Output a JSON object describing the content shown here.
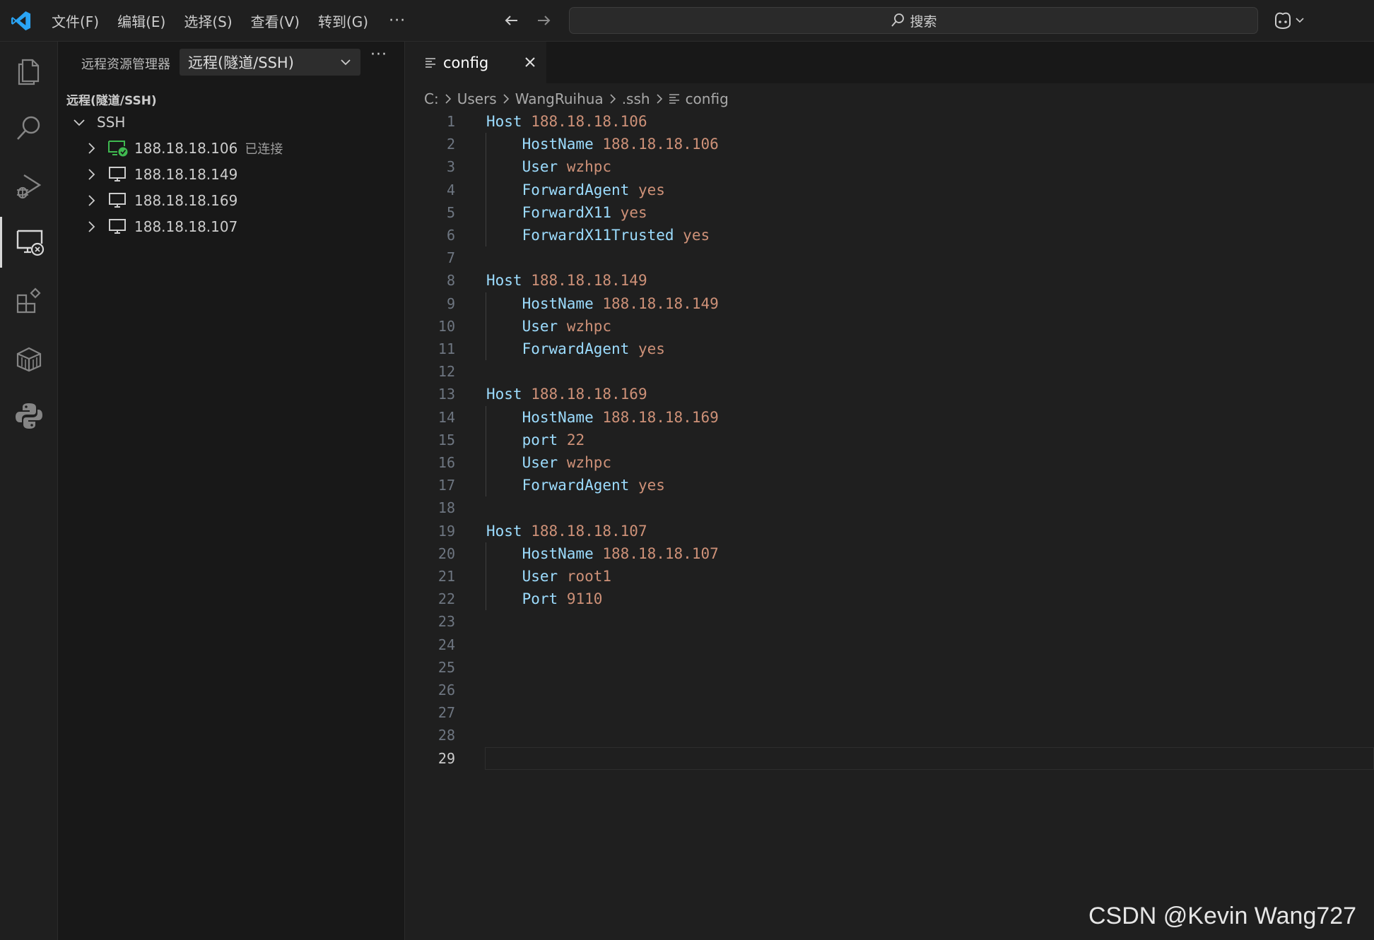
{
  "titlebar": {
    "menu": [
      "文件(F)",
      "编辑(E)",
      "选择(S)",
      "查看(V)",
      "转到(G)"
    ],
    "more_label": "···",
    "search_placeholder": "搜索"
  },
  "activity_icons": [
    "files-icon",
    "search-icon",
    "run-debug-icon",
    "remote-explorer-icon",
    "extensions-icon",
    "package-icon",
    "python-icon"
  ],
  "sidebar": {
    "title": "远程资源管理器",
    "dropdown_value": "远程(隧道/SSH)",
    "more_label": "···",
    "section_title": "远程(隧道/SSH)",
    "group_label": "SSH",
    "hosts": [
      {
        "label": "188.18.18.106",
        "status": "已连接",
        "connected": true
      },
      {
        "label": "188.18.18.149",
        "status": "",
        "connected": false
      },
      {
        "label": "188.18.18.169",
        "status": "",
        "connected": false
      },
      {
        "label": "188.18.18.107",
        "status": "",
        "connected": false
      }
    ]
  },
  "editor": {
    "tab_label": "config",
    "breadcrumb": [
      "C:",
      "Users",
      "WangRuihua",
      ".ssh",
      "config"
    ],
    "current_line": 29,
    "lines": [
      [
        "Host",
        "188.18.18.106",
        0
      ],
      [
        "HostName",
        "188.18.18.106",
        1
      ],
      [
        "User",
        "wzhpc",
        1
      ],
      [
        "ForwardAgent",
        "yes",
        1
      ],
      [
        "ForwardX11",
        "yes",
        1
      ],
      [
        "ForwardX11Trusted",
        "yes",
        1
      ],
      [
        "",
        "",
        0
      ],
      [
        "Host",
        "188.18.18.149",
        0
      ],
      [
        "HostName",
        "188.18.18.149",
        1
      ],
      [
        "User",
        "wzhpc",
        1
      ],
      [
        "ForwardAgent",
        "yes",
        1
      ],
      [
        "",
        "",
        0
      ],
      [
        "Host",
        "188.18.18.169",
        0
      ],
      [
        "HostName",
        "188.18.18.169",
        1
      ],
      [
        "port",
        "22",
        1
      ],
      [
        "User",
        "wzhpc",
        1
      ],
      [
        "ForwardAgent",
        "yes",
        1
      ],
      [
        "",
        "",
        0
      ],
      [
        "Host",
        "188.18.18.107",
        0
      ],
      [
        "HostName",
        "188.18.18.107",
        1
      ],
      [
        "User",
        "root1",
        1
      ],
      [
        "Port",
        "9110",
        1
      ],
      [
        "",
        "",
        0
      ],
      [
        "",
        "",
        0
      ],
      [
        "",
        "",
        0
      ],
      [
        "",
        "",
        0
      ],
      [
        "",
        "",
        0
      ],
      [
        "",
        "",
        0
      ],
      [
        "",
        "",
        0
      ]
    ]
  },
  "watermark": "CSDN @Kevin Wang727",
  "colors": {
    "keyword": "#9cdcfe",
    "value": "#ce9178",
    "accent": "#0078d4",
    "connected": "#3fb950"
  }
}
